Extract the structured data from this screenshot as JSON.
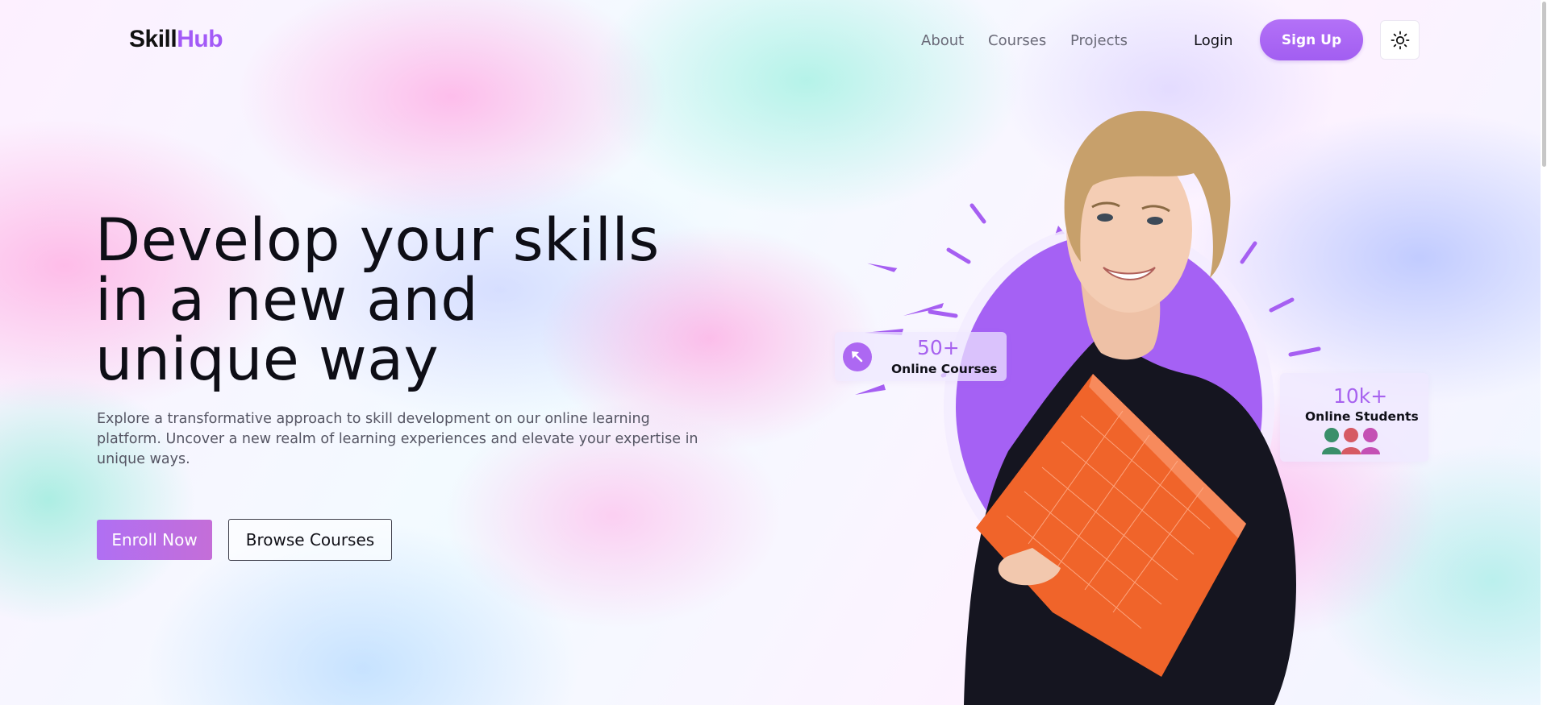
{
  "brand": {
    "logo_part1": "Skill",
    "logo_part2": "Hub"
  },
  "nav": {
    "items": [
      {
        "label": "About"
      },
      {
        "label": "Courses"
      },
      {
        "label": "Projects"
      }
    ],
    "login_label": "Login",
    "signup_label": "Sign Up",
    "theme_toggle_icon": "sun-icon"
  },
  "hero": {
    "headline_lines": [
      "Develop your skills",
      "in a new and",
      "unique way"
    ],
    "description": "Explore a transformative approach to skill development on our online learning platform. Uncover a new realm of learning experiences and elevate your expertise in unique ways.",
    "enroll_label": "Enroll Now",
    "browse_label": "Browse Courses"
  },
  "stats": {
    "courses": {
      "value": "50+",
      "label": "Online Courses",
      "icon": "arrow-up-left-icon"
    },
    "students": {
      "value": "10k+",
      "label": "Online Students",
      "icon": "user-avatars-icon"
    }
  },
  "colors": {
    "accent": "#a762ef",
    "text_dark": "#0e0e16",
    "text_muted": "#555563",
    "folder_orange": "#f0642a"
  }
}
